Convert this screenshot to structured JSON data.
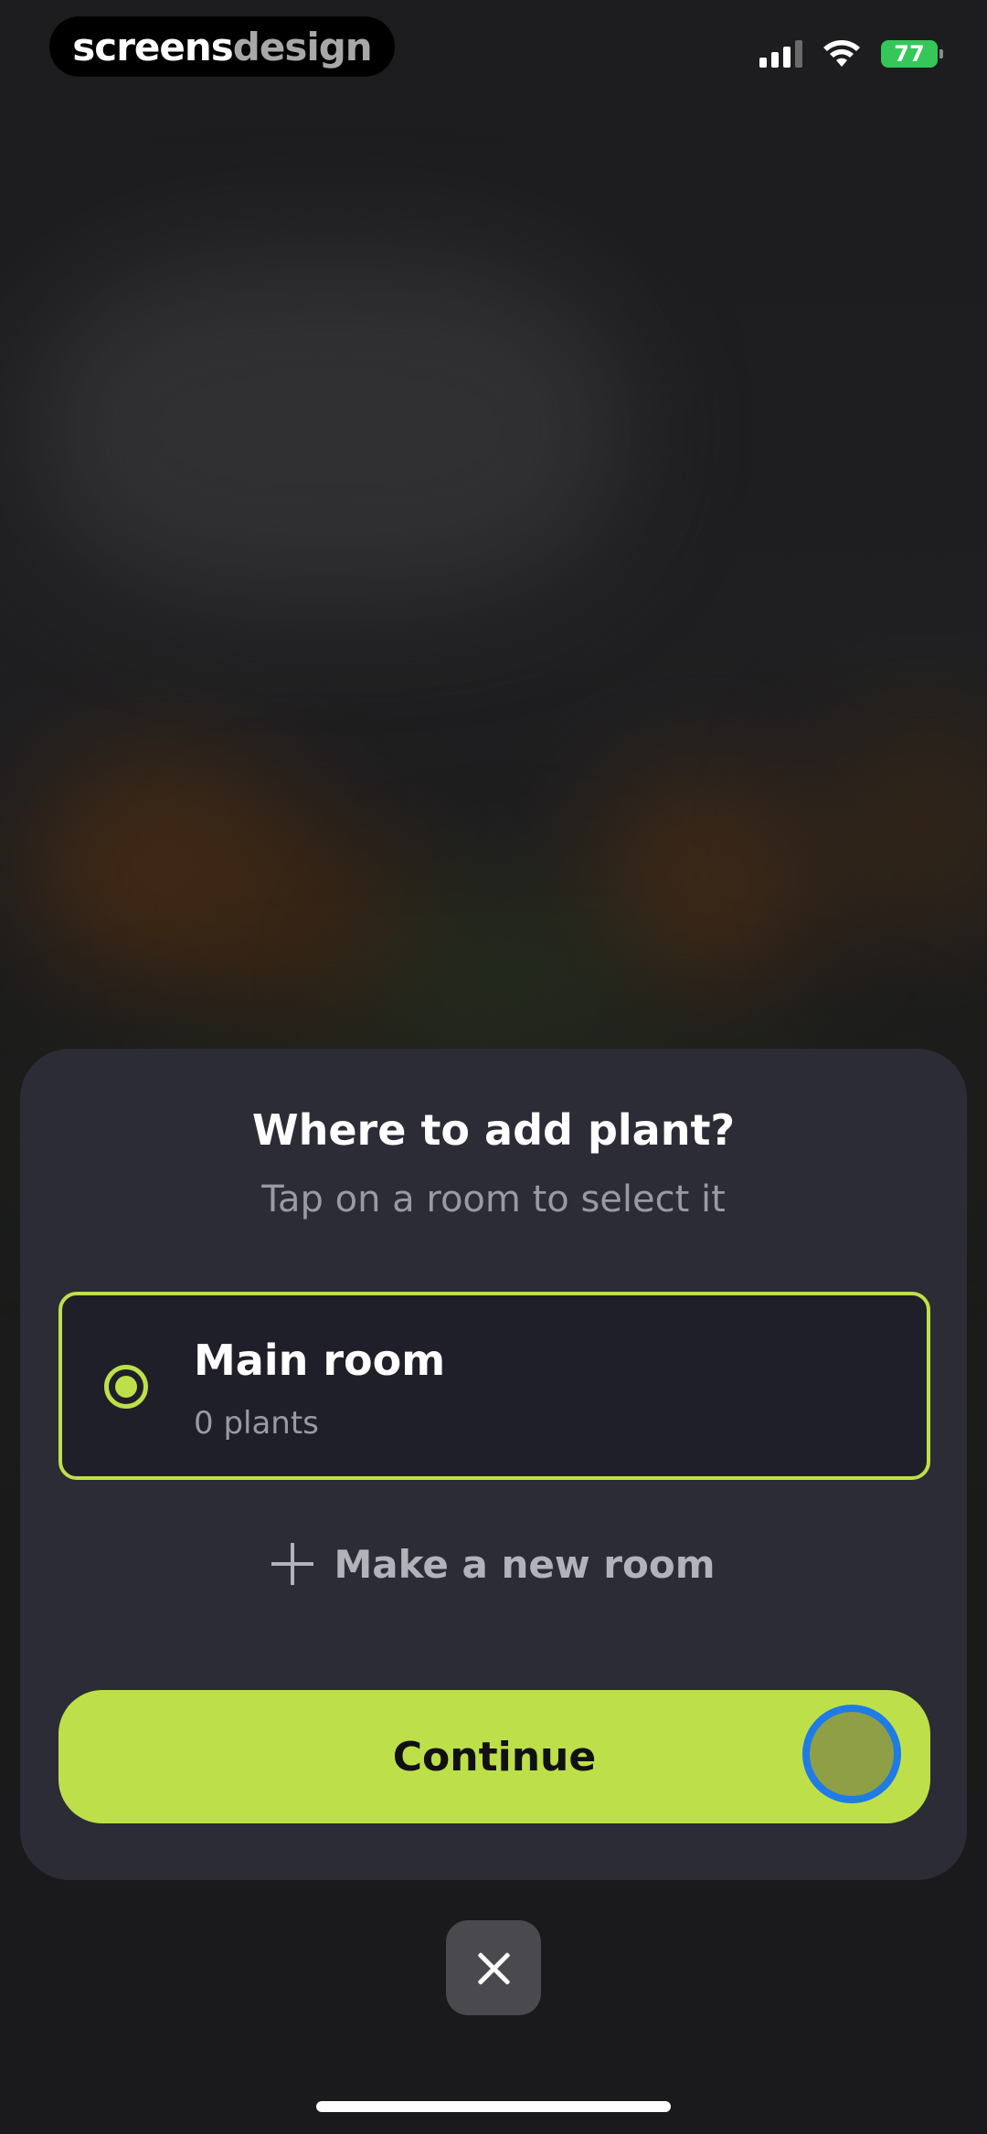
{
  "watermark": {
    "part1": "screens",
    "part2": "design"
  },
  "status_bar": {
    "battery": "77",
    "battery_color": "#35c759"
  },
  "sheet": {
    "title": "Where to add plant?",
    "subtitle": "Tap on a room to select it",
    "rooms": [
      {
        "name": "Main room",
        "count": "0 plants",
        "selected": true
      }
    ],
    "new_room_label": "Make a new room",
    "continue_label": "Continue"
  },
  "colors": {
    "accent": "#bde04a",
    "sheet_bg": "#2c2c36",
    "card_bg": "#1f1f29"
  },
  "icons": {
    "signal": "cellular-signal-icon",
    "wifi": "wifi-icon",
    "battery": "battery-icon",
    "add": "plus-icon",
    "close": "close-icon"
  }
}
